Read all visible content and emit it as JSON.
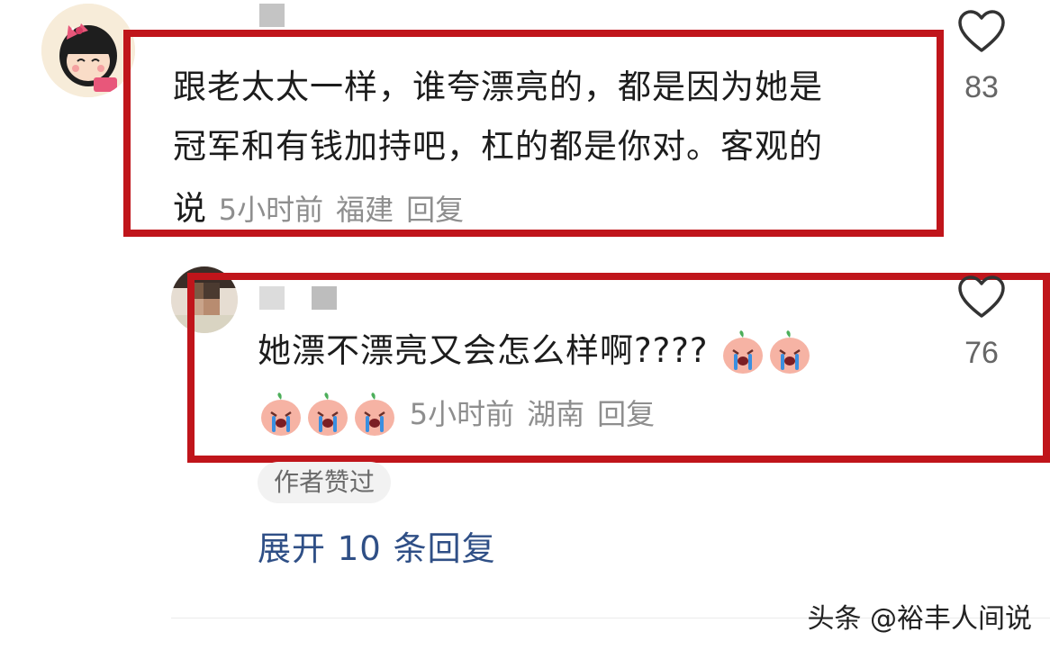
{
  "comments": [
    {
      "text_lines": [
        "跟老太太一样，谁夸漂亮的，都是因为她是",
        "冠军和有钱加持吧，杠的都是你对。客观的"
      ],
      "last_line_text": "说",
      "time": "5小时前",
      "location": "福建",
      "reply_label": "回复",
      "likes": "83"
    },
    {
      "text": "她漂不漂亮又会怎么样啊????",
      "time": "5小时前",
      "location": "湖南",
      "reply_label": "回复",
      "likes": "76",
      "author_badge": "作者赞过",
      "emoji_name": "crying-peach-emoji"
    }
  ],
  "expand_replies_label": "展开 10 条回复",
  "watermark": "头条 @裕丰人间说",
  "colors": {
    "highlight_box": "#c0151b",
    "link_blue": "#2f4f86",
    "meta_gray": "#8e8e8e"
  }
}
